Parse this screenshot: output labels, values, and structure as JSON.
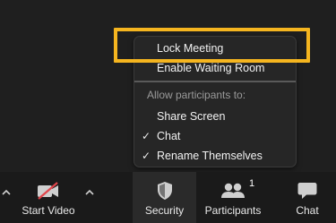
{
  "menu": {
    "items": [
      {
        "label": "Lock Meeting",
        "checked": false
      },
      {
        "label": "Enable Waiting Room",
        "checked": false
      }
    ],
    "section_title": "Allow participants to:",
    "permissions": [
      {
        "label": "Share Screen",
        "checked": false
      },
      {
        "label": "Chat",
        "checked": true
      },
      {
        "label": "Rename Themselves",
        "checked": true
      }
    ],
    "highlight_color": "#f5b51f"
  },
  "toolbar": {
    "start_video_label": "Start Video",
    "security_label": "Security",
    "participants_label": "Participants",
    "participants_count": "1",
    "chat_label": "Chat"
  },
  "icons": {
    "start_video": "video-off-icon",
    "security": "shield-icon",
    "participants": "participants-icon",
    "chat": "chat-bubble-icon",
    "caret": "chevron-up-icon",
    "check": "checkmark-icon"
  },
  "colors": {
    "background": "#1f1f1f",
    "menu_bg": "#262626",
    "toolbar_bg": "#1a1a1a",
    "video_off_slash": "#e0454b"
  }
}
